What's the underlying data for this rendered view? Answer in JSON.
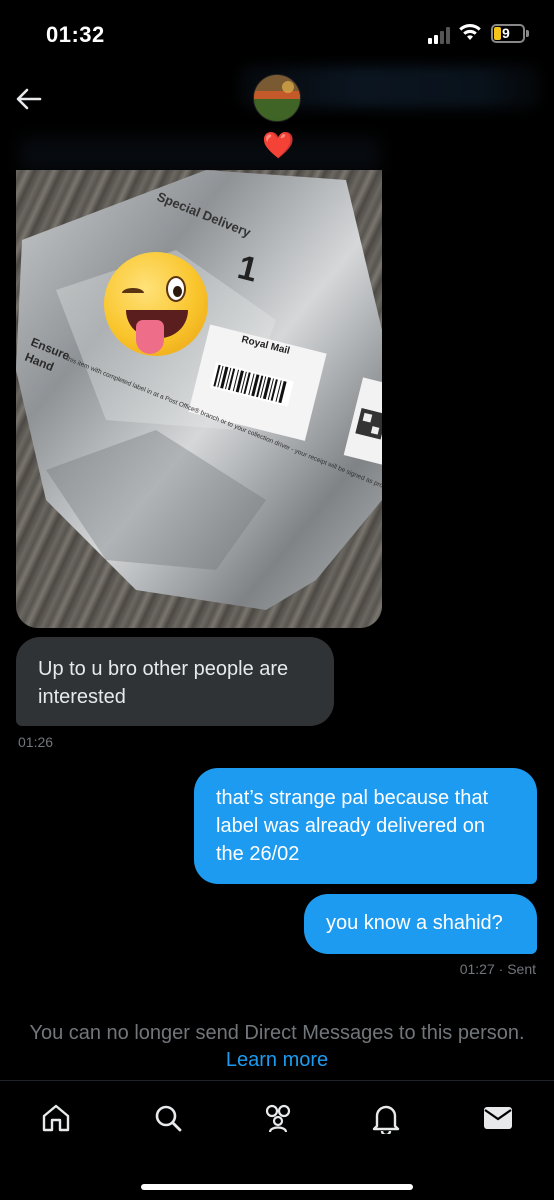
{
  "status_bar": {
    "time": "01:32",
    "battery_level": "9",
    "battery_color": "#f5c518"
  },
  "header": {
    "back_icon": "arrow-left-icon",
    "avatar": "avatar-image",
    "badge": "❤️"
  },
  "messages": [
    {
      "type": "image",
      "direction": "received",
      "description_icon": "photo-message"
    },
    {
      "type": "text",
      "direction": "received",
      "text": "Up to u bro other people are interested",
      "time": "01:26"
    },
    {
      "type": "text",
      "direction": "sent",
      "text": "that’s strange pal because that label was already delivered on the 26/02"
    },
    {
      "type": "text",
      "direction": "sent",
      "text": "you know a shahid?",
      "time": "01:27 · Sent"
    }
  ],
  "photo_text": {
    "bag_label": "Special Delivery",
    "ensure": "Ensure",
    "hand": "Hand",
    "label_brand": "Royal Mail",
    "instruction": "this item with completed label in at a Post Office® branch or to your collection driver - your receipt will be signed as proof of posting."
  },
  "notice": {
    "text": "You can no longer send Direct Messages to this person.",
    "link": "Learn more"
  },
  "tabbar": {
    "items": [
      "home-icon",
      "search-icon",
      "communities-icon",
      "notifications-icon",
      "messages-icon"
    ]
  },
  "colors": {
    "accent": "#1d9bf0",
    "received_bubble": "#2f3336",
    "muted_text": "#71767b",
    "background": "#000000"
  }
}
